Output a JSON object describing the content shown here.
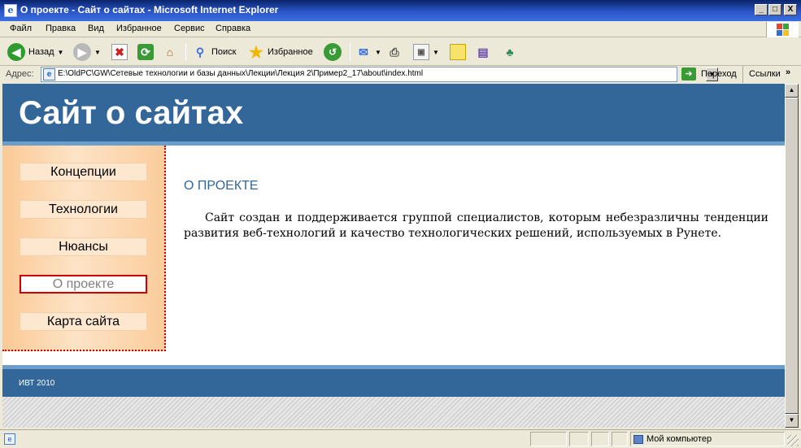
{
  "window": {
    "title": "О проекте - Сайт о сайтах - Microsoft Internet Explorer",
    "icon": "e",
    "controls": {
      "minimize": "_",
      "maximize": "□",
      "close": "X"
    }
  },
  "menu": {
    "items": [
      "Файл",
      "Правка",
      "Вид",
      "Избранное",
      "Сервис",
      "Справка"
    ]
  },
  "toolbar": {
    "back": "Назад",
    "search": "Поиск",
    "favorites": "Избранное"
  },
  "address": {
    "label": "Адрес:",
    "url": "E:\\OldPC\\GW\\Сетевые технологии и базы данных\\Лекции\\Лекция 2\\Пример2_17\\about\\index.html",
    "go": "Переход",
    "links": "Ссылки"
  },
  "site": {
    "title": "Сайт о сайтах",
    "nav": [
      "Концепции",
      "Технологии",
      "Нюансы",
      "О проекте",
      "Карта сайта"
    ],
    "active_nav": "О проекте",
    "heading": "О ПРОЕКТЕ",
    "text": "Сайт создан и поддерживается группой специалистов, которым небезразличны тенденции развития веб-технологий и качество технологических решений, используемых в Рунете.",
    "footer": "ИВТ 2010"
  },
  "status": {
    "zone": "Мой компьютер"
  },
  "colors": {
    "site_primary": "#336699",
    "site_accent": "#6a9ecd",
    "sidebar_bg": "#fde3c6",
    "active_border": "#cc0000"
  }
}
